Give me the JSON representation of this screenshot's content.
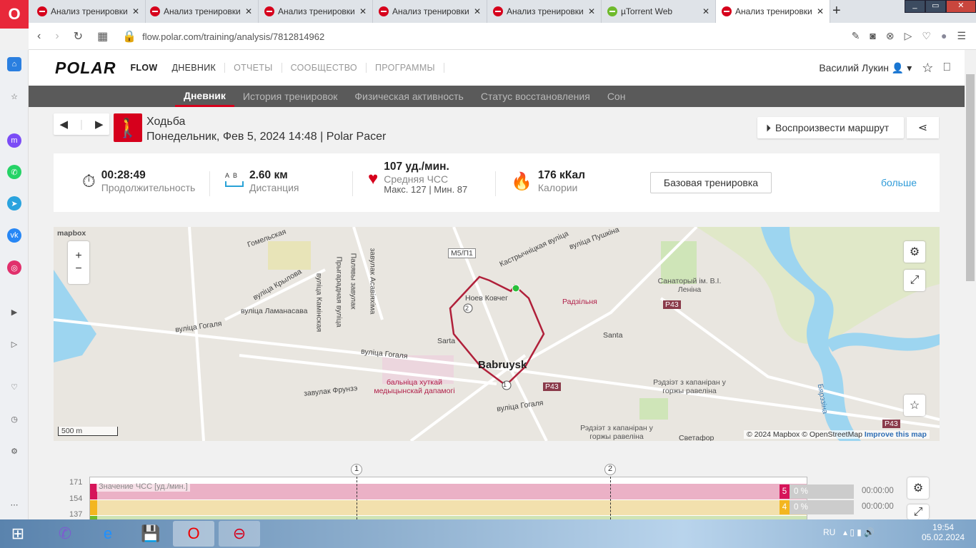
{
  "browser": {
    "tabs": [
      {
        "title": "Анализ тренировки"
      },
      {
        "title": "Анализ тренировки"
      },
      {
        "title": "Анализ тренировки"
      },
      {
        "title": "Анализ тренировки"
      },
      {
        "title": "Анализ тренировки"
      },
      {
        "title": "µTorrent Web"
      },
      {
        "title": "Анализ тренировки",
        "active": true
      }
    ],
    "url": "flow.polar.com/training/analysis/7812814962",
    "new_tab": "+"
  },
  "header": {
    "logo": "POLAR",
    "flow": "FLOW",
    "nav": [
      "ДНЕВНИК",
      "ОТЧЕТЫ",
      "СООБЩЕСТВО",
      "ПРОГРАММЫ"
    ],
    "user": "Василий Лукин"
  },
  "subnav": [
    "Дневник",
    "История тренировок",
    "Физическая активность",
    "Статус восстановления",
    "Сон"
  ],
  "training": {
    "sport": "Ходьба",
    "date_device": "Понедельник, Фев 5, 2024 14:48 | Polar Pacer",
    "replay": "Воспроизвести маршрут"
  },
  "summary": {
    "duration": {
      "value": "00:28:49",
      "label": "Продолжительность"
    },
    "distance": {
      "value": "2.60 км",
      "label": "Дистанция",
      "a": "A",
      "b": "B"
    },
    "hr": {
      "value": "107 уд./мин.",
      "label": "Средняя ЧСС",
      "minmax": "Макс. 127  |  Мин. 87"
    },
    "calories": {
      "value": "176 кКал",
      "label": "Калории"
    },
    "type_button": "Базовая тренировка",
    "more": "больше"
  },
  "map": {
    "brand": "mapbox",
    "scale": "500 m",
    "attribution": [
      "© 2024 Mapbox",
      "© OpenStreetMap",
      "Improve this map"
    ],
    "labels": [
      "Гомельская",
      "вуліца Крылова",
      "вуліца Ламанасава",
      "вуліца Гогаля",
      "вуліца Гогаля",
      "завулак Фрунзэ",
      "вуліца Камінская",
      "Прыгарадная вуліца",
      "Палявы завулак",
      "завулак Асавіяхіма",
      "M5/П1",
      "Кастрычніцкая вуліца",
      "вуліца Пушкіна",
      "Ноев Ковчег",
      "Радзільня",
      "Santa",
      "Sarta",
      "Babruysk",
      "бальніца хуткай медыцынскай дапамогі",
      "Санаторый ім. В.І. Леніна",
      "Рэдзіэт з капаніран у горжы равеліна",
      "Рэдзіэт з капаніран у горжы равеліна",
      "P43",
      "P43",
      "P43",
      "Бярэзіна",
      "Светафор",
      "вуліца Гогаля"
    ],
    "markers": [
      "1",
      "2"
    ]
  },
  "chart": {
    "legend": "Значение ЧСС [уд./мин.]",
    "yticks": [
      "171",
      "154",
      "137"
    ],
    "laps": [
      "1",
      "2"
    ],
    "zones": [
      {
        "num": "5",
        "pct": "0 %",
        "time": "00:00:00",
        "color": "#d6145a"
      },
      {
        "num": "4",
        "pct": "0 %",
        "time": "00:00:00",
        "color": "#f3b61f"
      }
    ]
  },
  "taskbar": {
    "lang": "RU",
    "time": "19:54",
    "date": "05.02.2024"
  }
}
